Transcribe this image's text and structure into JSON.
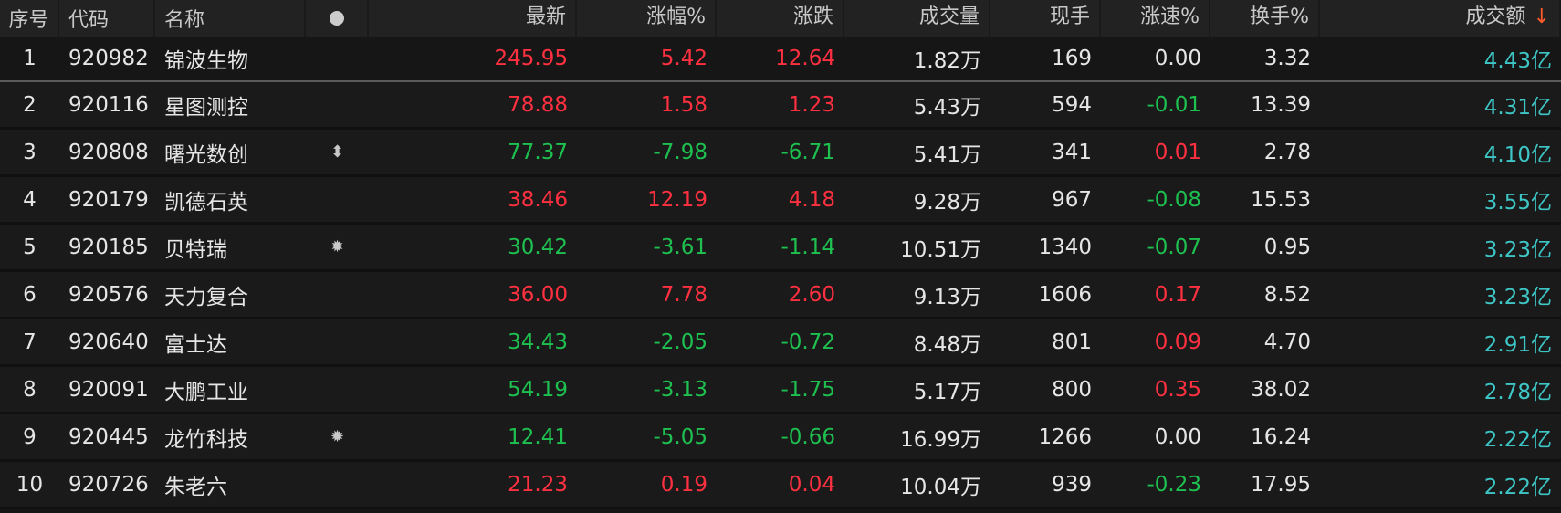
{
  "headers": {
    "seq": "序号",
    "code": "代码",
    "name": "名称",
    "last": "最新",
    "pct": "涨幅%",
    "chg": "涨跌",
    "vol": "成交量",
    "hand": "现手",
    "speed": "涨速%",
    "turn": "换手%",
    "amount": "成交额",
    "sort_arrow": "↓"
  },
  "rows": [
    {
      "seq": "1",
      "code": "920982",
      "name": "锦波生物",
      "icon": "",
      "last": "245.95",
      "pct": "5.42",
      "chg": "12.64",
      "vol": "1.82万",
      "hand": "169",
      "speed": "0.00",
      "turn": "3.32",
      "amount": "4.43亿",
      "dir": "up",
      "sdir": "flat"
    },
    {
      "seq": "2",
      "code": "920116",
      "name": "星图测控",
      "icon": "",
      "last": "78.88",
      "pct": "1.58",
      "chg": "1.23",
      "vol": "5.43万",
      "hand": "594",
      "speed": "-0.01",
      "turn": "13.39",
      "amount": "4.31亿",
      "dir": "up",
      "sdir": "dn"
    },
    {
      "seq": "3",
      "code": "920808",
      "name": "曙光数创",
      "icon": "⬍",
      "last": "77.37",
      "pct": "-7.98",
      "chg": "-6.71",
      "vol": "5.41万",
      "hand": "341",
      "speed": "0.01",
      "turn": "2.78",
      "amount": "4.10亿",
      "dir": "dn",
      "sdir": "up"
    },
    {
      "seq": "4",
      "code": "920179",
      "name": "凯德石英",
      "icon": "",
      "last": "38.46",
      "pct": "12.19",
      "chg": "4.18",
      "vol": "9.28万",
      "hand": "967",
      "speed": "-0.08",
      "turn": "15.53",
      "amount": "3.55亿",
      "dir": "up",
      "sdir": "dn"
    },
    {
      "seq": "5",
      "code": "920185",
      "name": "贝特瑞",
      "icon": "✹",
      "last": "30.42",
      "pct": "-3.61",
      "chg": "-1.14",
      "vol": "10.51万",
      "hand": "1340",
      "speed": "-0.07",
      "turn": "0.95",
      "amount": "3.23亿",
      "dir": "dn",
      "sdir": "dn"
    },
    {
      "seq": "6",
      "code": "920576",
      "name": "天力复合",
      "icon": "",
      "last": "36.00",
      "pct": "7.78",
      "chg": "2.60",
      "vol": "9.13万",
      "hand": "1606",
      "speed": "0.17",
      "turn": "8.52",
      "amount": "3.23亿",
      "dir": "up",
      "sdir": "up"
    },
    {
      "seq": "7",
      "code": "920640",
      "name": "富士达",
      "icon": "",
      "last": "34.43",
      "pct": "-2.05",
      "chg": "-0.72",
      "vol": "8.48万",
      "hand": "801",
      "speed": "0.09",
      "turn": "4.70",
      "amount": "2.91亿",
      "dir": "dn",
      "sdir": "up"
    },
    {
      "seq": "8",
      "code": "920091",
      "name": "大鹏工业",
      "icon": "",
      "last": "54.19",
      "pct": "-3.13",
      "chg": "-1.75",
      "vol": "5.17万",
      "hand": "800",
      "speed": "0.35",
      "turn": "38.02",
      "amount": "2.78亿",
      "dir": "dn",
      "sdir": "up"
    },
    {
      "seq": "9",
      "code": "920445",
      "name": "龙竹科技",
      "icon": "✹",
      "last": "12.41",
      "pct": "-5.05",
      "chg": "-0.66",
      "vol": "16.99万",
      "hand": "1266",
      "speed": "0.00",
      "turn": "16.24",
      "amount": "2.22亿",
      "dir": "dn",
      "sdir": "flat"
    },
    {
      "seq": "10",
      "code": "920726",
      "name": "朱老六",
      "icon": "",
      "last": "21.23",
      "pct": "0.19",
      "chg": "0.04",
      "vol": "10.04万",
      "hand": "939",
      "speed": "-0.23",
      "turn": "17.95",
      "amount": "2.22亿",
      "dir": "up",
      "sdir": "dn"
    }
  ]
}
